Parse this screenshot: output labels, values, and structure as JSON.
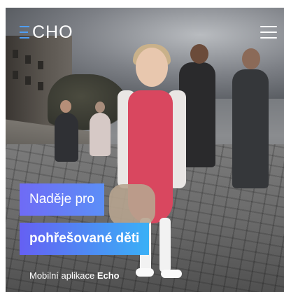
{
  "header": {
    "logo_text": "CHO",
    "logo_accent_color": "#4f9df3",
    "menu_icon": "hamburger-icon"
  },
  "hero": {
    "headline_line1": "Naděje pro",
    "headline_line2": "pohřešované děti",
    "subtitle_prefix": "Mobilní aplikace",
    "subtitle_brand": "Echo",
    "gradient_colors": [
      "#6560f3",
      "#3ab0f6"
    ]
  }
}
